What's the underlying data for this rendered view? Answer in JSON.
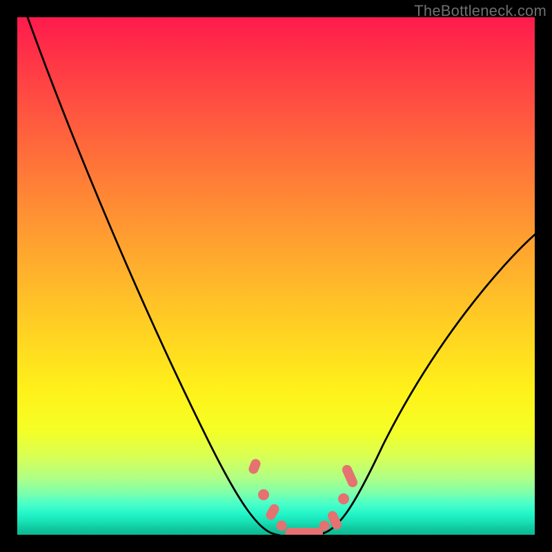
{
  "watermark": "TheBottleneck.com",
  "chart_data": {
    "type": "line",
    "title": "",
    "xlabel": "",
    "ylabel": "",
    "xlim": [
      0,
      100
    ],
    "ylim": [
      0,
      100
    ],
    "grid": false,
    "series": [
      {
        "name": "bottleneck-curve",
        "x": [
          2,
          5,
          10,
          15,
          20,
          25,
          30,
          35,
          40,
          45,
          48,
          50,
          52,
          55,
          58,
          60,
          62,
          65,
          70,
          75,
          80,
          85,
          90,
          95,
          100
        ],
        "values": [
          100,
          93,
          82,
          72,
          62,
          53,
          44,
          35,
          26,
          15,
          7,
          2,
          0,
          0,
          0,
          2,
          6,
          12,
          21,
          29,
          36,
          42,
          48,
          53,
          58
        ]
      }
    ],
    "markers": {
      "name": "highlighted-points",
      "color": "#e57171",
      "x": [
        45.5,
        47.5,
        49.5,
        51,
        53,
        55,
        57,
        59,
        60.5,
        62,
        63.5
      ],
      "values": [
        13,
        8,
        4,
        1.5,
        0,
        0,
        0,
        1.5,
        3.5,
        6,
        10
      ]
    },
    "gradient_stops": [
      {
        "pos": 0,
        "color": "#ff1a4d"
      },
      {
        "pos": 0.48,
        "color": "#ffae2d"
      },
      {
        "pos": 0.72,
        "color": "#fff11a"
      },
      {
        "pos": 0.92,
        "color": "#7cffac"
      },
      {
        "pos": 1.0,
        "color": "#0cb893"
      }
    ]
  }
}
